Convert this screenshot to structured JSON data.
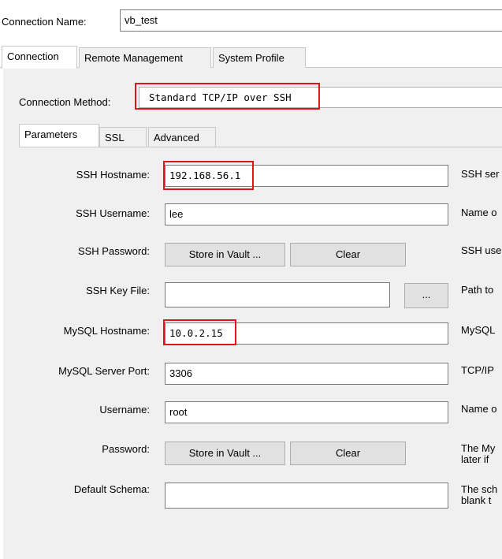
{
  "connection_name": {
    "label": "Connection Name:",
    "value": "vb_test"
  },
  "top_tabs": [
    "Connection",
    "Remote Management",
    "System Profile"
  ],
  "connection_method": {
    "label": "Connection Method:",
    "value": "Standard TCP/IP over SSH"
  },
  "sub_tabs": [
    "Parameters",
    "SSL",
    "Advanced"
  ],
  "params": {
    "ssh_hostname": {
      "label": "SSH Hostname:",
      "value": "192.168.56.1",
      "desc": "SSH ser"
    },
    "ssh_username": {
      "label": "SSH Username:",
      "value": "lee",
      "desc": "Name o"
    },
    "ssh_password": {
      "label": "SSH Password:",
      "store_label": "Store in Vault ...",
      "clear_label": "Clear",
      "desc": "SSH use"
    },
    "ssh_key_file": {
      "label": "SSH Key File:",
      "value": "",
      "browse_label": "...",
      "desc": "Path to"
    },
    "mysql_hostname": {
      "label": "MySQL Hostname:",
      "value": "10.0.2.15",
      "desc": "MySQL"
    },
    "mysql_port": {
      "label": "MySQL Server Port:",
      "value": "3306",
      "desc": "TCP/IP"
    },
    "username": {
      "label": "Username:",
      "value": "root",
      "desc": "Name o"
    },
    "password": {
      "label": "Password:",
      "store_label": "Store in Vault ...",
      "clear_label": "Clear",
      "desc_line1": "The My",
      "desc_line2": "later if"
    },
    "default_schema": {
      "label": "Default Schema:",
      "value": "",
      "desc_line1": "The sch",
      "desc_line2": "blank t"
    }
  },
  "colors": {
    "highlight": "#e0141a",
    "panel": "#f0f0f0",
    "content": "#ffffff"
  }
}
